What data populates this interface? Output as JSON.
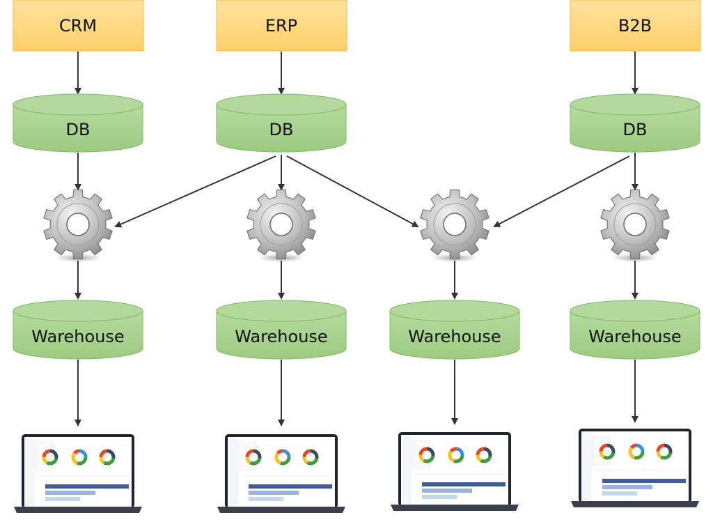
{
  "sources": [
    {
      "label": "CRM"
    },
    {
      "label": "ERP"
    },
    {
      "label": "B2B"
    }
  ],
  "databases": [
    {
      "label": "DB"
    },
    {
      "label": "DB"
    },
    {
      "label": "DB"
    }
  ],
  "warehouses": [
    {
      "label": "Warehouse"
    },
    {
      "label": "Warehouse"
    },
    {
      "label": "Warehouse"
    },
    {
      "label": "Warehouse"
    }
  ],
  "process_icon": "gear-icon",
  "dashboard_icon": "laptop-dashboard-icon",
  "colors": {
    "source_fill": "#FFD47A",
    "source_stroke": "#F2B84B",
    "db_fill": "#A8D18D",
    "db_stroke": "#7FB865",
    "arrow": "#333333"
  }
}
